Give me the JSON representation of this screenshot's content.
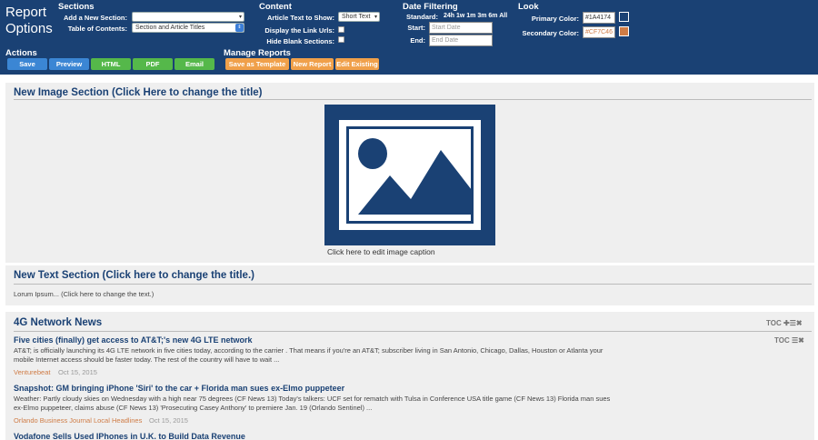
{
  "toolbar": {
    "title_line1": "Report",
    "title_line2": "Options",
    "sections": {
      "heading": "Sections",
      "add_label": "Add a New Section:",
      "add_value": "",
      "toc_label": "Table of Contents:",
      "toc_value": "Section and Article Titles"
    },
    "content": {
      "heading": "Content",
      "article_text_label": "Article Text to Show:",
      "article_text_value": "Short Text",
      "display_link_label": "Display the Link Urls:",
      "hide_blank_label": "Hide Blank Sections:"
    },
    "date": {
      "heading": "Date Filtering",
      "standard_label": "Standard:",
      "standard_options": "24h  1w  1m  3m  6m  All",
      "start_label": "Start:",
      "start_placeholder": "Start Date",
      "end_label": "End:",
      "end_placeholder": "End Date"
    },
    "look": {
      "heading": "Look",
      "primary_label": "Primary Color:",
      "primary_value": "#1A4174",
      "secondary_label": "Secondary Color:",
      "secondary_value": "#CF7C46"
    },
    "actions": {
      "heading": "Actions",
      "save": "Save",
      "preview": "Preview",
      "html": "HTML",
      "pdf": "PDF",
      "email": "Email"
    },
    "manage": {
      "heading": "Manage Reports",
      "save_template": "Save as Template",
      "new_report": "New Report",
      "edit_existing": "Edit Existing"
    }
  },
  "image_section": {
    "title": "New Image Section (Click Here to change the title)",
    "caption": "Click here to edit image caption"
  },
  "text_section": {
    "title": "New Text Section (Click here to change the title.)",
    "body": "Lorum Ipsum... (Click here to change the text.)"
  },
  "news_section": {
    "title": "4G Network News",
    "toc_label": "TOC",
    "articles": [
      {
        "title": "Five cities (finally) get access to AT&T;'s new 4G LTE network",
        "body": "AT&T; is officially launching its 4G LTE network in five cities today, according to the carrier . That means if you're an AT&T; subscriber living in San Antonio, Chicago, Dallas, Houston or Atlanta your mobile Internet access should be faster today. The rest of the country will have to wait ...",
        "source": "Venturebeat",
        "date": "Oct 15, 2015"
      },
      {
        "title": "Snapshot: GM bringing iPhone 'Siri' to the car + Florida man sues ex-Elmo puppeteer",
        "body": "Weather: Partly cloudy skies on Wednesday with a high near 75 degrees (CF News 13) Today's talkers: UCF set for rematch with Tulsa in Conference USA title game (CF News 13) Florida man sues ex-Elmo puppeteer, claims abuse (CF News 13) 'Prosecuting Casey Anthony' to premiere Jan. 19 (Orlando Sentinel) ...",
        "source": "Orlando Business Journal Local Headlines",
        "date": "Oct 15, 2015"
      },
      {
        "title": "Vodafone Sells Used IPhones in U.K. to Build Data Revenue"
      }
    ]
  },
  "colors": {
    "primary": "#1A4174",
    "secondary": "#CF7C46"
  }
}
